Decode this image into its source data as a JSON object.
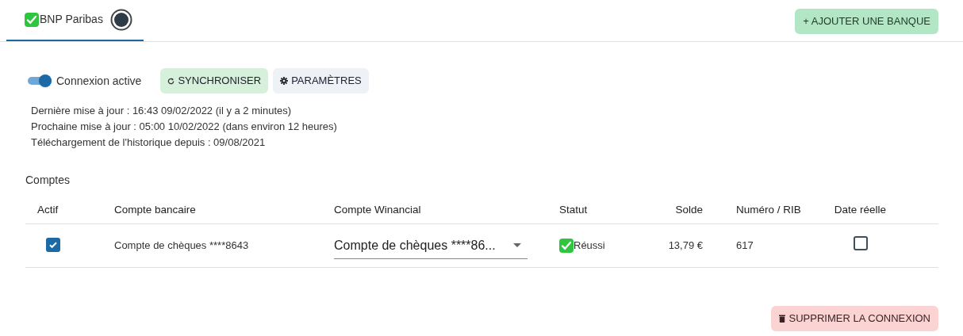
{
  "tabs": [
    {
      "label": "BNP Paribas",
      "kind": "success",
      "selected": true
    }
  ],
  "add_button": "+ AJOUTER UNE BANQUE",
  "connection": {
    "toggle_label": "Connexion active",
    "on": true
  },
  "sync_button": "SYNCHRONISER",
  "settings_button": "PARAMÈTRES",
  "info_lines": [
    "Dernière mise à jour : 16:43 09/02/2022 (il y a 2 minutes)",
    "Prochaine mise à jour : 05:00 10/02/2022 (dans environ 12 heures)",
    "Téléchargement de l'historique depuis : 09/08/2021"
  ],
  "accounts": {
    "title": "Comptes",
    "columns": [
      "Actif",
      "Compte bancaire",
      "Compte Winancial",
      "Statut",
      "Solde",
      "Numéro / RIB",
      "Date réelle"
    ],
    "rows": [
      {
        "active": true,
        "bank_account": "Compte de chèques ****8643",
        "winancial_account": "Compte de chèques ****86...",
        "status": "Réussi",
        "kind": "success",
        "balance": "13,79 €",
        "number": "617",
        "real_date": false
      }
    ]
  },
  "delete_button": "SUPPRIMER LA CONNEXION"
}
